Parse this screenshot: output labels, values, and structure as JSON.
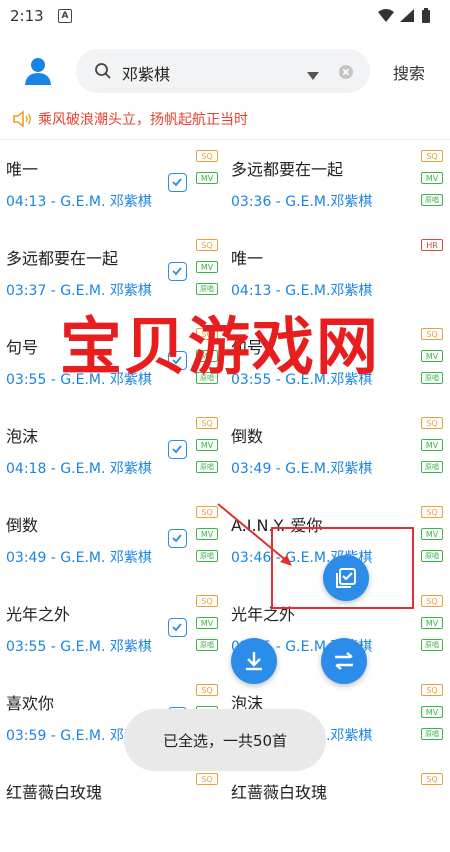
{
  "status_bar": {
    "time": "2:13",
    "notification_icon": "A"
  },
  "header": {
    "search_value": "邓紫棋",
    "search_button": "搜索"
  },
  "notice": {
    "text": "乘风破浪潮头立，扬帆起航正当时"
  },
  "songs": [
    {
      "title": "唯一",
      "meta": "04:13 - G.E.M. 邓紫棋",
      "checked": true,
      "badges": [
        "SQ",
        "MV"
      ]
    },
    {
      "title": "多远都要在一起",
      "meta": "03:36 - G.E.M.邓紫棋",
      "checked": false,
      "badges": [
        "SQ",
        "MV",
        "原唱"
      ]
    },
    {
      "title": "多远都要在一起",
      "meta": "03:37 - G.E.M. 邓紫棋",
      "checked": true,
      "badges": [
        "SQ",
        "MV",
        "原唱"
      ]
    },
    {
      "title": "唯一",
      "meta": "04:13 - G.E.M.邓紫棋",
      "checked": false,
      "badges": [
        "HR"
      ]
    },
    {
      "title": "句号",
      "meta": "03:55 - G.E.M. 邓紫棋",
      "checked": true,
      "badges": [
        "SQ",
        "MV",
        "原唱"
      ]
    },
    {
      "title": "句号",
      "meta": "03:55 - G.E.M.邓紫棋",
      "checked": false,
      "badges": [
        "SQ",
        "MV",
        "原唱"
      ]
    },
    {
      "title": "泡沫",
      "meta": "04:18 - G.E.M. 邓紫棋",
      "checked": true,
      "badges": [
        "SQ",
        "MV",
        "原唱"
      ]
    },
    {
      "title": "倒数",
      "meta": "03:49 - G.E.M.邓紫棋",
      "checked": false,
      "badges": [
        "SQ",
        "MV",
        "原唱"
      ]
    },
    {
      "title": "倒数",
      "meta": "03:49 - G.E.M. 邓紫棋",
      "checked": true,
      "badges": [
        "SQ",
        "MV",
        "原唱"
      ]
    },
    {
      "title": "A.I.N.Y. 爱你",
      "meta": "03:46 - G.E.M.邓紫棋",
      "checked": false,
      "badges": [
        "SQ",
        "MV",
        "原唱"
      ]
    },
    {
      "title": "光年之外",
      "meta": "03:55 - G.E.M. 邓紫棋",
      "checked": true,
      "badges": [
        "SQ",
        "MV",
        "原唱"
      ]
    },
    {
      "title": "光年之外",
      "meta": "03:55 - G.E.M.邓紫棋",
      "checked": false,
      "badges": [
        "SQ",
        "MV",
        "原唱"
      ]
    },
    {
      "title": "喜欢你",
      "meta": "03:59 - G.E.M. 邓紫棋",
      "checked": true,
      "badges": [
        "SQ",
        "MV",
        "原唱"
      ]
    },
    {
      "title": "泡沫",
      "meta": "04:18 - G.E.M.邓紫棋",
      "checked": false,
      "badges": [
        "SQ",
        "MV",
        "原唱"
      ]
    },
    {
      "title": "红蔷薇白玫瑰",
      "meta": "",
      "checked": false,
      "badges": [
        "SQ"
      ]
    },
    {
      "title": "红蔷薇白玫瑰",
      "meta": "",
      "checked": false,
      "badges": [
        "SQ"
      ]
    }
  ],
  "watermark": "宝贝游戏网",
  "toast": {
    "text": "已全选，一共50首"
  },
  "icons": {
    "avatar": "user-icon",
    "search": "search-icon",
    "dropdown": "chevron-down-icon",
    "clear": "clear-icon",
    "speaker": "speaker-icon",
    "select_all": "select-all-icon",
    "download": "download-icon",
    "swap": "swap-icon"
  },
  "colors": {
    "accent": "#2b8cea",
    "notice": "#e8402e",
    "meta": "#1a84e6",
    "watermark": "#e81e1e",
    "annotation": "#e23030"
  }
}
